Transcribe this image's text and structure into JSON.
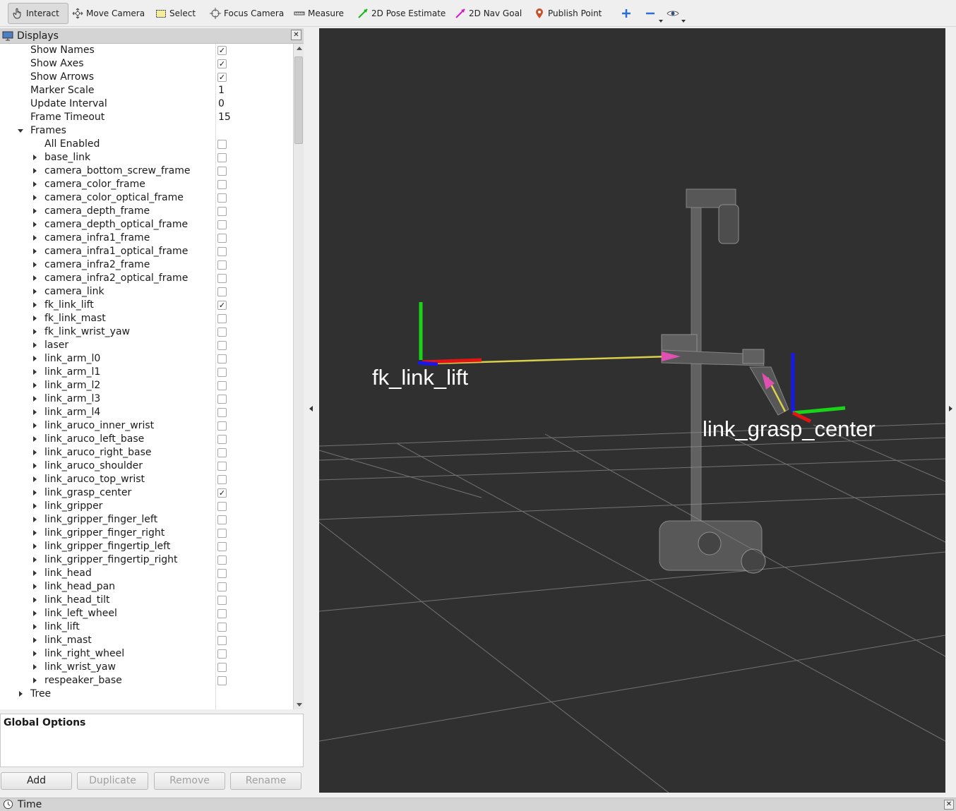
{
  "toolbar": {
    "tools": [
      {
        "id": "interact",
        "label": "Interact",
        "icon": "hand-pointer-icon",
        "active": true
      },
      {
        "id": "move",
        "label": "Move Camera",
        "icon": "move-camera-icon"
      },
      {
        "id": "select",
        "label": "Select",
        "icon": "select-box-icon"
      },
      {
        "id": "focus",
        "label": "Focus Camera",
        "icon": "crosshair-icon"
      },
      {
        "id": "measure",
        "label": "Measure",
        "icon": "ruler-icon"
      },
      {
        "id": "pose",
        "label": "2D Pose Estimate",
        "icon": "green-arrow-icon"
      },
      {
        "id": "nav",
        "label": "2D Nav Goal",
        "icon": "magenta-arrow-icon"
      },
      {
        "id": "publish",
        "label": "Publish Point",
        "icon": "map-pin-icon"
      }
    ]
  },
  "displays": {
    "title": "Displays",
    "properties": [
      {
        "label": "Show Names",
        "checked": true
      },
      {
        "label": "Show Axes",
        "checked": true
      },
      {
        "label": "Show Arrows",
        "checked": true
      },
      {
        "label": "Marker Scale",
        "value": "1"
      },
      {
        "label": "Update Interval",
        "value": "0"
      },
      {
        "label": "Frame Timeout",
        "value": "15"
      }
    ],
    "frames_label": "Frames",
    "all_enabled_label": "All Enabled",
    "frames": [
      {
        "name": "base_link",
        "checked": false
      },
      {
        "name": "camera_bottom_screw_frame",
        "checked": false
      },
      {
        "name": "camera_color_frame",
        "checked": false
      },
      {
        "name": "camera_color_optical_frame",
        "checked": false
      },
      {
        "name": "camera_depth_frame",
        "checked": false
      },
      {
        "name": "camera_depth_optical_frame",
        "checked": false
      },
      {
        "name": "camera_infra1_frame",
        "checked": false
      },
      {
        "name": "camera_infra1_optical_frame",
        "checked": false
      },
      {
        "name": "camera_infra2_frame",
        "checked": false
      },
      {
        "name": "camera_infra2_optical_frame",
        "checked": false
      },
      {
        "name": "camera_link",
        "checked": false
      },
      {
        "name": "fk_link_lift",
        "checked": true
      },
      {
        "name": "fk_link_mast",
        "checked": false
      },
      {
        "name": "fk_link_wrist_yaw",
        "checked": false
      },
      {
        "name": "laser",
        "checked": false
      },
      {
        "name": "link_arm_l0",
        "checked": false
      },
      {
        "name": "link_arm_l1",
        "checked": false
      },
      {
        "name": "link_arm_l2",
        "checked": false
      },
      {
        "name": "link_arm_l3",
        "checked": false
      },
      {
        "name": "link_arm_l4",
        "checked": false
      },
      {
        "name": "link_aruco_inner_wrist",
        "checked": false
      },
      {
        "name": "link_aruco_left_base",
        "checked": false
      },
      {
        "name": "link_aruco_right_base",
        "checked": false
      },
      {
        "name": "link_aruco_shoulder",
        "checked": false
      },
      {
        "name": "link_aruco_top_wrist",
        "checked": false
      },
      {
        "name": "link_grasp_center",
        "checked": true
      },
      {
        "name": "link_gripper",
        "checked": false
      },
      {
        "name": "link_gripper_finger_left",
        "checked": false
      },
      {
        "name": "link_gripper_finger_right",
        "checked": false
      },
      {
        "name": "link_gripper_fingertip_left",
        "checked": false
      },
      {
        "name": "link_gripper_fingertip_right",
        "checked": false
      },
      {
        "name": "link_head",
        "checked": false
      },
      {
        "name": "link_head_pan",
        "checked": false
      },
      {
        "name": "link_head_tilt",
        "checked": false
      },
      {
        "name": "link_left_wheel",
        "checked": false
      },
      {
        "name": "link_lift",
        "checked": false
      },
      {
        "name": "link_mast",
        "checked": false
      },
      {
        "name": "link_right_wheel",
        "checked": false
      },
      {
        "name": "link_wrist_yaw",
        "checked": false
      },
      {
        "name": "respeaker_base",
        "checked": false
      }
    ],
    "tree_label": "Tree"
  },
  "description": {
    "title": "Global Options"
  },
  "buttons": {
    "add": "Add",
    "duplicate": "Duplicate",
    "remove": "Remove",
    "rename": "Rename"
  },
  "viewport": {
    "frame_labels": {
      "fk_link_lift": "fk_link_lift",
      "link_grasp_center": "link_grasp_center"
    },
    "background": "#303030"
  },
  "time_panel": {
    "title": "Time"
  }
}
